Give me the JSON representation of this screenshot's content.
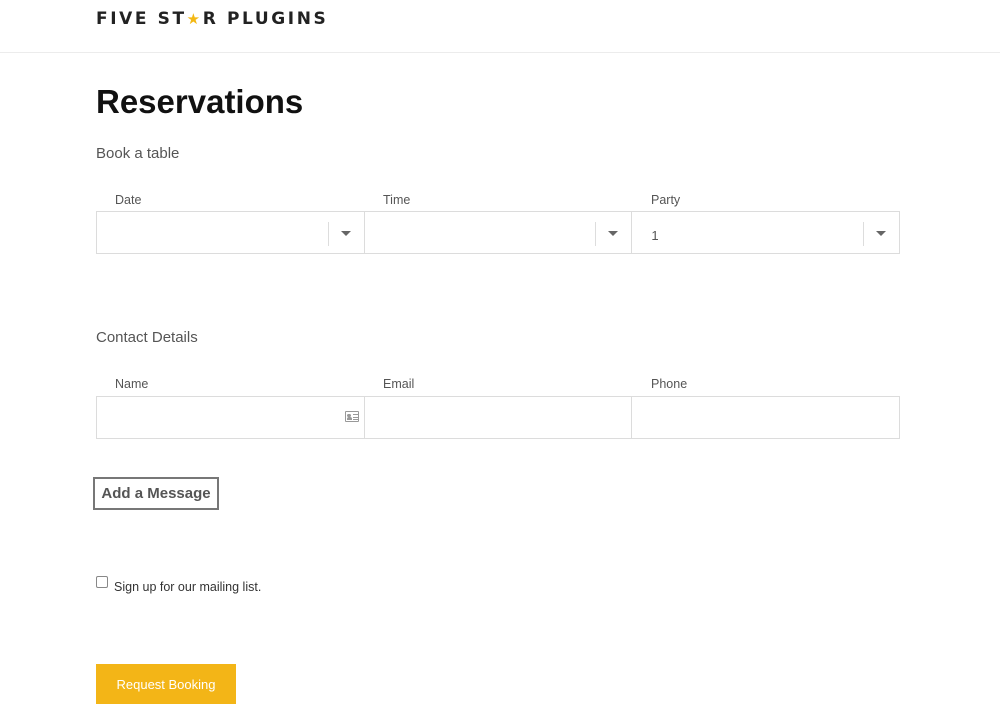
{
  "header": {
    "logo_part1": "FIVE ST",
    "logo_star": "★",
    "logo_part2": "R PLUGINS"
  },
  "page": {
    "title": "Reservations"
  },
  "booking": {
    "section_label": "Book a table",
    "fields": [
      {
        "label": "Date",
        "value": ""
      },
      {
        "label": "Time",
        "value": ""
      },
      {
        "label": "Party",
        "value": "1"
      }
    ]
  },
  "contact": {
    "section_label": "Contact Details",
    "fields": [
      {
        "label": "Name",
        "value": ""
      },
      {
        "label": "Email",
        "value": ""
      },
      {
        "label": "Phone",
        "value": ""
      }
    ]
  },
  "message_button": "Add a Message",
  "mailing_list": {
    "label": "Sign up for our mailing list.",
    "checked": false
  },
  "submit_button": "Request Booking",
  "colors": {
    "accent": "#f3b517",
    "star": "#f3b814"
  }
}
